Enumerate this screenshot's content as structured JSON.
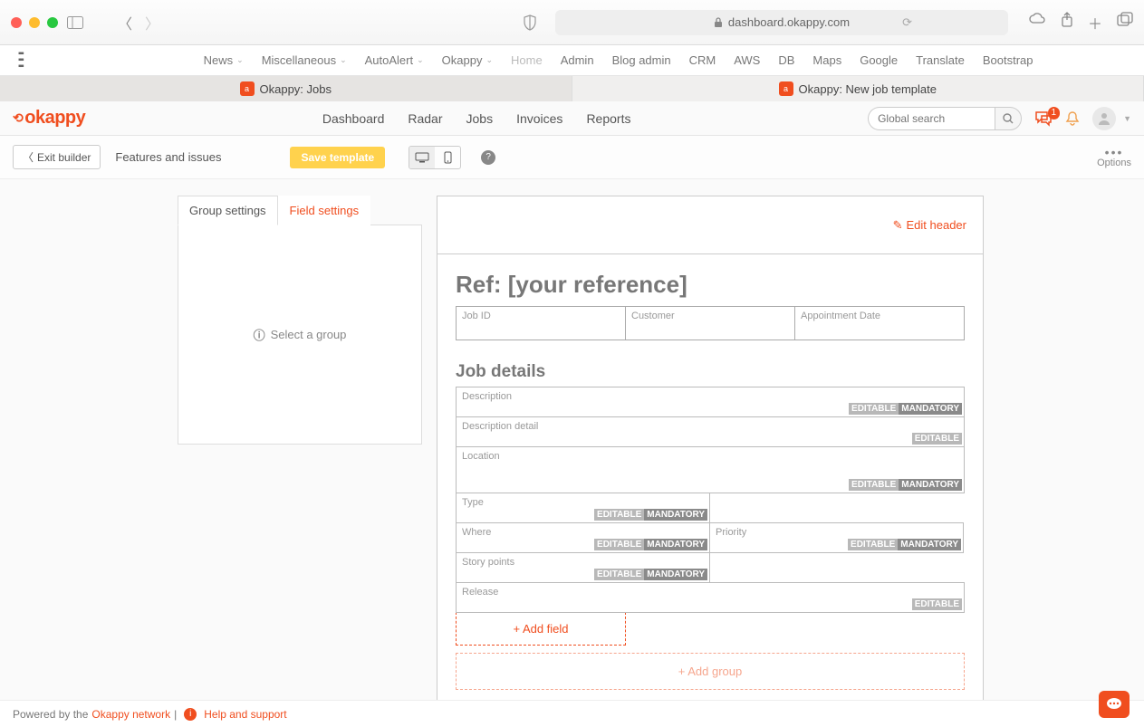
{
  "browser": {
    "url": "dashboard.okappy.com",
    "bookmarks": [
      "News",
      "Miscellaneous",
      "AutoAlert",
      "Okappy",
      "Home",
      "Admin",
      "Blog admin",
      "CRM",
      "AWS",
      "DB",
      "Maps",
      "Google",
      "Translate",
      "Bootstrap"
    ],
    "tabs": [
      {
        "label": "Okappy: Jobs",
        "active": true
      },
      {
        "label": "Okappy: New job template",
        "active": false
      }
    ]
  },
  "app": {
    "logo": "okappy",
    "nav": [
      "Dashboard",
      "Radar",
      "Jobs",
      "Invoices",
      "Reports"
    ],
    "search_placeholder": "Global search",
    "chat_count": "1"
  },
  "toolbar": {
    "exit": "Exit builder",
    "features": "Features and issues",
    "save": "Save template",
    "options": "Options"
  },
  "left": {
    "tab1": "Group settings",
    "tab2": "Field settings",
    "empty": "Select a group"
  },
  "canvas": {
    "edit_header": "Edit header",
    "ref_title": "Ref: [your reference]",
    "meta": [
      "Job ID",
      "Customer",
      "Appointment Date"
    ],
    "section": "Job details",
    "fields": [
      {
        "label": "Description",
        "w": "full",
        "editable": true,
        "mandatory": true
      },
      {
        "label": "Description detail",
        "w": "full",
        "editable": true,
        "mandatory": false
      },
      {
        "label": "Location",
        "w": "full",
        "editable": true,
        "mandatory": true,
        "tall": true
      },
      {
        "label": "Type",
        "w": "half",
        "editable": true,
        "mandatory": true
      },
      {
        "label": "Where",
        "w": "half",
        "editable": true,
        "mandatory": true,
        "pair": "Priority",
        "pair_editable": true,
        "pair_mandatory": true
      },
      {
        "label": "Story points",
        "w": "half",
        "editable": true,
        "mandatory": true
      },
      {
        "label": "Release",
        "w": "full",
        "editable": true,
        "mandatory": false
      }
    ],
    "add_field": "+ Add field",
    "add_group": "+ Add group",
    "tag_editable": "EDITABLE",
    "tag_mandatory": "MANDATORY"
  },
  "footer": {
    "powered": "Powered by the ",
    "network": "Okappy network",
    "help": "Help and support"
  }
}
